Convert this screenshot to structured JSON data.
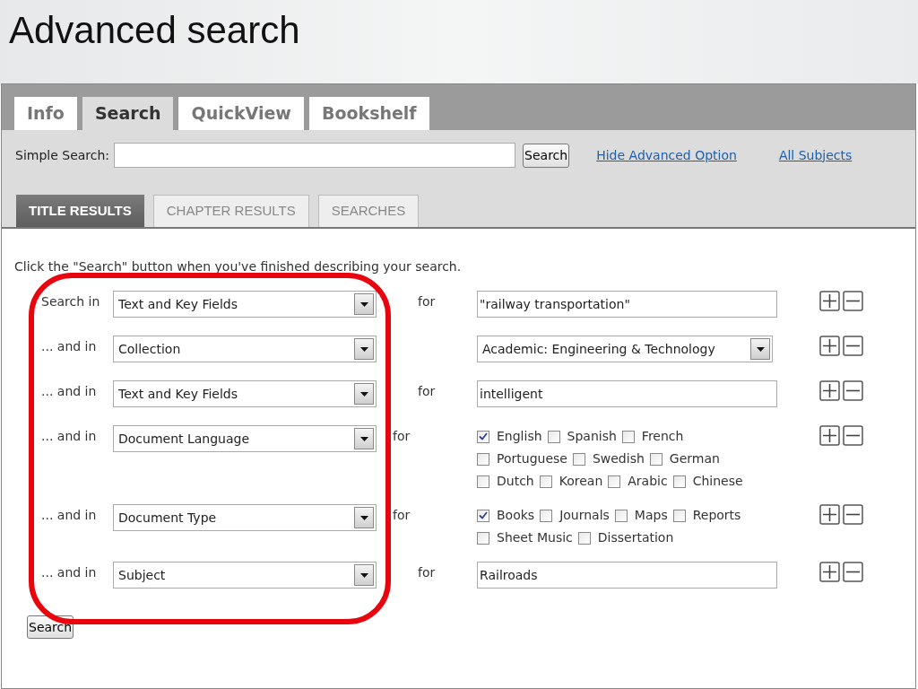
{
  "slide_title": "Advanced search",
  "tabs": [
    {
      "label": "Info",
      "selected": false
    },
    {
      "label": "Search",
      "selected": true
    },
    {
      "label": "QuickView",
      "selected": false
    },
    {
      "label": "Bookshelf",
      "selected": false
    }
  ],
  "simple_search": {
    "label": "Simple Search:",
    "button": "Search",
    "links": [
      "Hide Advanced Option",
      "All Subjects"
    ]
  },
  "result_tabs": [
    {
      "label": "TITLE RESULTS",
      "selected": true
    },
    {
      "label": "CHAPTER RESULTS",
      "selected": false
    },
    {
      "label": "SEARCHES",
      "selected": false
    }
  ],
  "instruction": "Click the \"Search\" button when you've finished describing your search.",
  "rows": [
    {
      "label": "Search in",
      "field": "Text and Key Fields",
      "for": "for",
      "kind": "text",
      "value": "\"railway transportation\""
    },
    {
      "label": "... and in",
      "field": "Collection",
      "kind": "select",
      "value": "Academic: Engineering & Technology"
    },
    {
      "label": "... and in",
      "field": "Text and Key Fields",
      "for": "for",
      "kind": "text",
      "value": "intelligent"
    },
    {
      "label": "... and in",
      "field": "Document Language",
      "for": "for",
      "kind": "checkboxes",
      "lines": [
        [
          {
            "label": "English",
            "checked": true
          },
          {
            "label": "Spanish",
            "checked": false
          },
          {
            "label": "French",
            "checked": false
          }
        ],
        [
          {
            "label": "Portuguese",
            "checked": false
          },
          {
            "label": "Swedish",
            "checked": false
          },
          {
            "label": "German",
            "checked": false
          }
        ],
        [
          {
            "label": "Dutch",
            "checked": false
          },
          {
            "label": "Korean",
            "checked": false
          },
          {
            "label": "Arabic",
            "checked": false
          },
          {
            "label": "Chinese",
            "checked": false
          }
        ]
      ]
    },
    {
      "label": "... and in",
      "field": "Document Type",
      "for": "for",
      "kind": "checkboxes",
      "lines": [
        [
          {
            "label": "Books",
            "checked": true
          },
          {
            "label": "Journals",
            "checked": false
          },
          {
            "label": "Maps",
            "checked": false
          },
          {
            "label": "Reports",
            "checked": false
          }
        ],
        [
          {
            "label": "Sheet Music",
            "checked": false
          },
          {
            "label": "Dissertation",
            "checked": false
          }
        ]
      ]
    },
    {
      "label": "... and in",
      "field": "Subject",
      "for": "for",
      "kind": "text",
      "value": "Railroads"
    }
  ],
  "search_button": "Search"
}
